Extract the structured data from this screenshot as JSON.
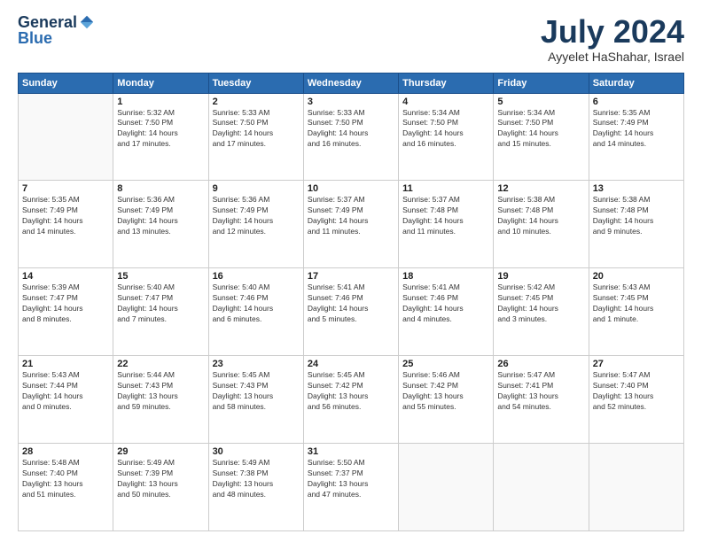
{
  "logo": {
    "general": "General",
    "blue": "Blue"
  },
  "header": {
    "month_year": "July 2024",
    "location": "Ayyelet HaShahar, Israel"
  },
  "days_of_week": [
    "Sunday",
    "Monday",
    "Tuesday",
    "Wednesday",
    "Thursday",
    "Friday",
    "Saturday"
  ],
  "weeks": [
    [
      {
        "day": "",
        "info": ""
      },
      {
        "day": "1",
        "info": "Sunrise: 5:32 AM\nSunset: 7:50 PM\nDaylight: 14 hours\nand 17 minutes."
      },
      {
        "day": "2",
        "info": "Sunrise: 5:33 AM\nSunset: 7:50 PM\nDaylight: 14 hours\nand 17 minutes."
      },
      {
        "day": "3",
        "info": "Sunrise: 5:33 AM\nSunset: 7:50 PM\nDaylight: 14 hours\nand 16 minutes."
      },
      {
        "day": "4",
        "info": "Sunrise: 5:34 AM\nSunset: 7:50 PM\nDaylight: 14 hours\nand 16 minutes."
      },
      {
        "day": "5",
        "info": "Sunrise: 5:34 AM\nSunset: 7:50 PM\nDaylight: 14 hours\nand 15 minutes."
      },
      {
        "day": "6",
        "info": "Sunrise: 5:35 AM\nSunset: 7:49 PM\nDaylight: 14 hours\nand 14 minutes."
      }
    ],
    [
      {
        "day": "7",
        "info": "Sunrise: 5:35 AM\nSunset: 7:49 PM\nDaylight: 14 hours\nand 14 minutes."
      },
      {
        "day": "8",
        "info": "Sunrise: 5:36 AM\nSunset: 7:49 PM\nDaylight: 14 hours\nand 13 minutes."
      },
      {
        "day": "9",
        "info": "Sunrise: 5:36 AM\nSunset: 7:49 PM\nDaylight: 14 hours\nand 12 minutes."
      },
      {
        "day": "10",
        "info": "Sunrise: 5:37 AM\nSunset: 7:49 PM\nDaylight: 14 hours\nand 11 minutes."
      },
      {
        "day": "11",
        "info": "Sunrise: 5:37 AM\nSunset: 7:48 PM\nDaylight: 14 hours\nand 11 minutes."
      },
      {
        "day": "12",
        "info": "Sunrise: 5:38 AM\nSunset: 7:48 PM\nDaylight: 14 hours\nand 10 minutes."
      },
      {
        "day": "13",
        "info": "Sunrise: 5:38 AM\nSunset: 7:48 PM\nDaylight: 14 hours\nand 9 minutes."
      }
    ],
    [
      {
        "day": "14",
        "info": "Sunrise: 5:39 AM\nSunset: 7:47 PM\nDaylight: 14 hours\nand 8 minutes."
      },
      {
        "day": "15",
        "info": "Sunrise: 5:40 AM\nSunset: 7:47 PM\nDaylight: 14 hours\nand 7 minutes."
      },
      {
        "day": "16",
        "info": "Sunrise: 5:40 AM\nSunset: 7:46 PM\nDaylight: 14 hours\nand 6 minutes."
      },
      {
        "day": "17",
        "info": "Sunrise: 5:41 AM\nSunset: 7:46 PM\nDaylight: 14 hours\nand 5 minutes."
      },
      {
        "day": "18",
        "info": "Sunrise: 5:41 AM\nSunset: 7:46 PM\nDaylight: 14 hours\nand 4 minutes."
      },
      {
        "day": "19",
        "info": "Sunrise: 5:42 AM\nSunset: 7:45 PM\nDaylight: 14 hours\nand 3 minutes."
      },
      {
        "day": "20",
        "info": "Sunrise: 5:43 AM\nSunset: 7:45 PM\nDaylight: 14 hours\nand 1 minute."
      }
    ],
    [
      {
        "day": "21",
        "info": "Sunrise: 5:43 AM\nSunset: 7:44 PM\nDaylight: 14 hours\nand 0 minutes."
      },
      {
        "day": "22",
        "info": "Sunrise: 5:44 AM\nSunset: 7:43 PM\nDaylight: 13 hours\nand 59 minutes."
      },
      {
        "day": "23",
        "info": "Sunrise: 5:45 AM\nSunset: 7:43 PM\nDaylight: 13 hours\nand 58 minutes."
      },
      {
        "day": "24",
        "info": "Sunrise: 5:45 AM\nSunset: 7:42 PM\nDaylight: 13 hours\nand 56 minutes."
      },
      {
        "day": "25",
        "info": "Sunrise: 5:46 AM\nSunset: 7:42 PM\nDaylight: 13 hours\nand 55 minutes."
      },
      {
        "day": "26",
        "info": "Sunrise: 5:47 AM\nSunset: 7:41 PM\nDaylight: 13 hours\nand 54 minutes."
      },
      {
        "day": "27",
        "info": "Sunrise: 5:47 AM\nSunset: 7:40 PM\nDaylight: 13 hours\nand 52 minutes."
      }
    ],
    [
      {
        "day": "28",
        "info": "Sunrise: 5:48 AM\nSunset: 7:40 PM\nDaylight: 13 hours\nand 51 minutes."
      },
      {
        "day": "29",
        "info": "Sunrise: 5:49 AM\nSunset: 7:39 PM\nDaylight: 13 hours\nand 50 minutes."
      },
      {
        "day": "30",
        "info": "Sunrise: 5:49 AM\nSunset: 7:38 PM\nDaylight: 13 hours\nand 48 minutes."
      },
      {
        "day": "31",
        "info": "Sunrise: 5:50 AM\nSunset: 7:37 PM\nDaylight: 13 hours\nand 47 minutes."
      },
      {
        "day": "",
        "info": ""
      },
      {
        "day": "",
        "info": ""
      },
      {
        "day": "",
        "info": ""
      }
    ]
  ]
}
